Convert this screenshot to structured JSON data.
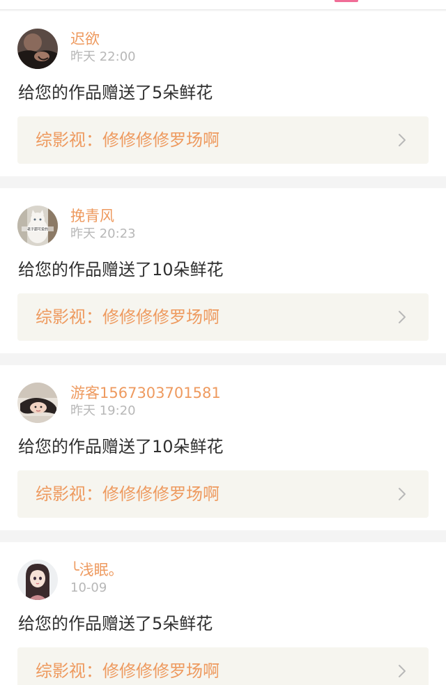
{
  "colors": {
    "accent_orange": "#ee9a5f",
    "tab_indicator": "#f06d97",
    "link_bg": "#f6f5ef",
    "time_gray": "#b7b7b7",
    "text_dark": "#2f2f2f"
  },
  "items": [
    {
      "username": "迟欲",
      "time": "昨天 22:00",
      "message": "给您的作品赠送了5朵鲜花",
      "work_label": "综影视：修修修修罗场啊",
      "avatar_icon": "avatar-dark-portrait"
    },
    {
      "username": "挽青风",
      "time": "昨天 20:23",
      "message": "给您的作品赠送了10朵鲜花",
      "work_label": "综影视：修修修修罗场啊",
      "avatar_icon": "avatar-white-cat",
      "avatar_caption": "老子超可爱的"
    },
    {
      "username": "游客1567303701581",
      "time": "昨天 19:20",
      "message": "给您的作品赠送了10朵鲜花",
      "work_label": "综影视：修修修修罗场啊",
      "avatar_icon": "avatar-girl-photo"
    },
    {
      "username": "╰浅眠。",
      "time": "10-09",
      "message": "给您的作品赠送了5朵鲜花",
      "work_label": "综影视：修修修修罗场啊",
      "avatar_icon": "avatar-anime-girl"
    }
  ]
}
